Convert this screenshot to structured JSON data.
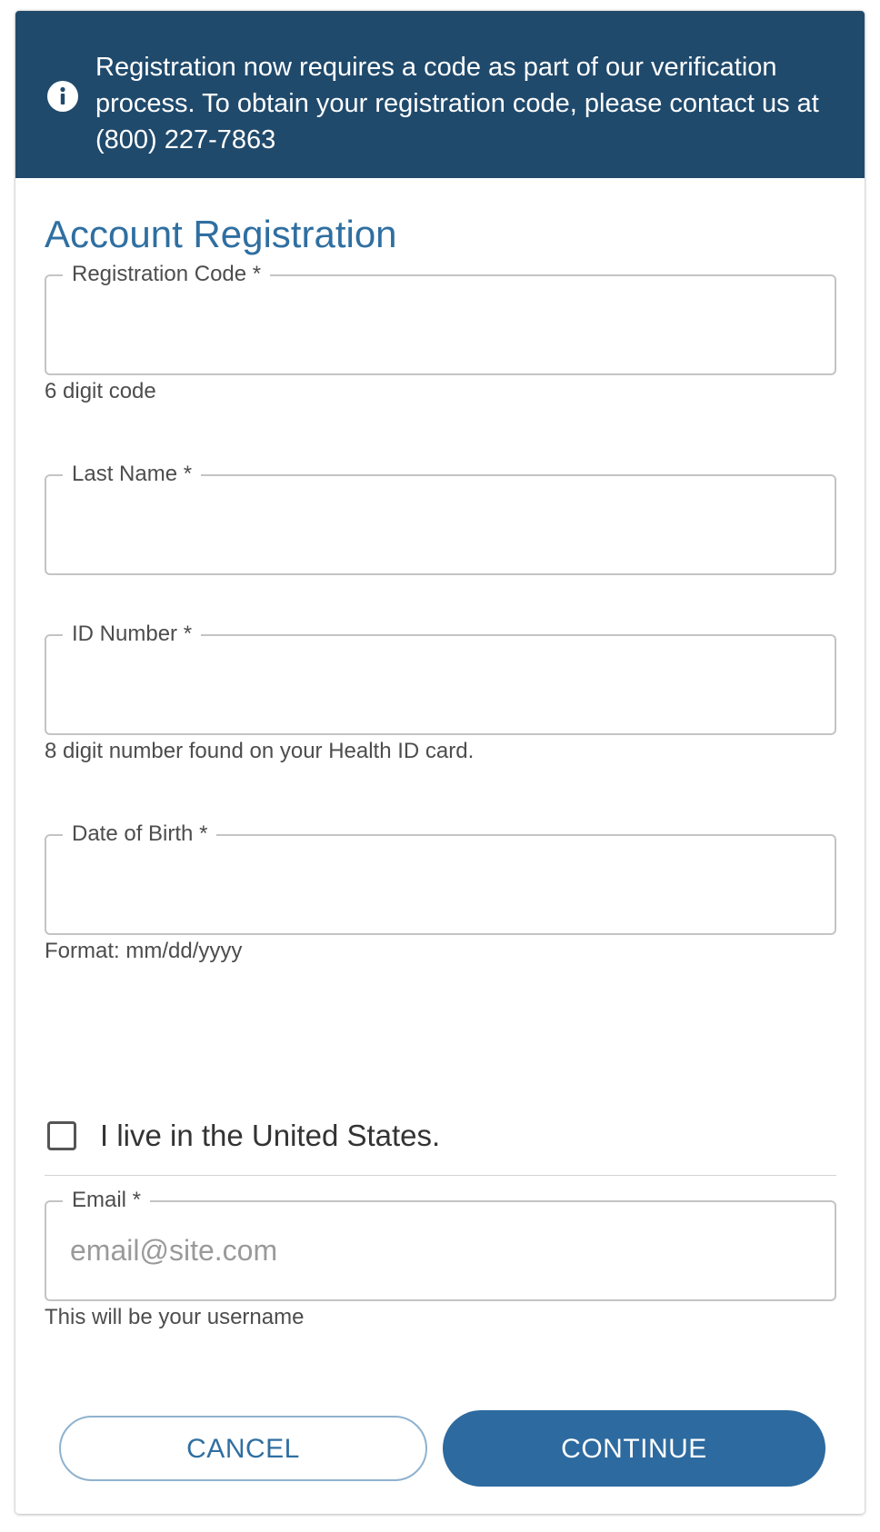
{
  "banner": {
    "text": "Registration now requires a code as part of our verification process. To obtain your registration code, please contact us at (800) 227-7863",
    "icon": "info-icon"
  },
  "title": "Account Registration",
  "fields": {
    "registration_code": {
      "label": "Registration Code *",
      "value": "",
      "hint": "6 digit code"
    },
    "last_name": {
      "label": "Last Name *",
      "value": ""
    },
    "id_number": {
      "label": "ID Number *",
      "value": "",
      "hint": "8 digit number found on your Health ID card."
    },
    "dob": {
      "label": "Date of Birth *",
      "value": "",
      "hint": "Format: mm/dd/yyyy"
    },
    "email": {
      "label": "Email *",
      "value": "",
      "placeholder": "email@site.com",
      "hint": "This will be your username"
    }
  },
  "us_resident": {
    "label": "I live in the United States.",
    "checked": false
  },
  "buttons": {
    "cancel": "CANCEL",
    "continue": "CONTINUE"
  },
  "colors": {
    "banner_bg": "#204a6c",
    "accent": "#2f6fa1",
    "primary_button": "#2d6a9f"
  }
}
